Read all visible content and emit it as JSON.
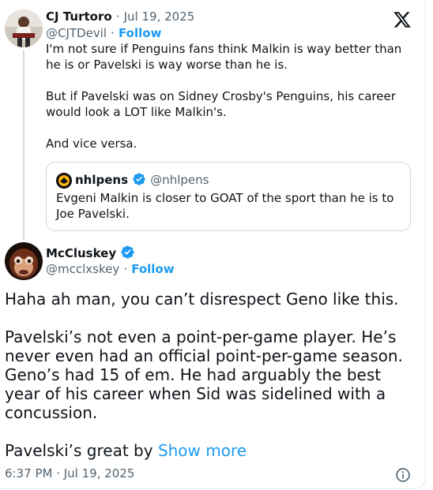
{
  "colors": {
    "accent": "#1d9bf0",
    "text": "#0f1419",
    "muted": "#536471",
    "border": "#cfd9de"
  },
  "x_logo_icon": "x-logo",
  "reply_tweet": {
    "author_name": "CJ Turtoro",
    "sep1": "·",
    "date": "Jul 19, 2025",
    "handle": "@CJTDevil",
    "sep2": "·",
    "follow_label": "Follow",
    "body": "I'm not sure if Penguins fans think Malkin is way better than he is or Pavelski is way worse than he is.\n\nBut if Pavelski was on Sidney Crosby's Penguins, his career would look a LOT like Malkin's.\n\nAnd vice versa.",
    "quote": {
      "author_name": "nhlpens",
      "handle": "@nhlpens",
      "body": "Evgeni Malkin is closer to GOAT of the sport than he is to Joe Pavelski."
    }
  },
  "main_tweet": {
    "author_name": "McCluskey",
    "handle": "@mcclxskey",
    "sep": "·",
    "follow_label": "Follow",
    "body": "Haha ah man, you can’t disrespect Geno like this.\n\nPavelski’s not even a point-per-game player. He’s never even had an official point-per-game season. Geno’s had 15 of em. He had arguably the best year of his career when Sid was sidelined with a concussion.\n\nPavelski’s great by ",
    "show_more_label": "Show more",
    "timestamp": "6:37 PM · Jul 19, 2025"
  }
}
